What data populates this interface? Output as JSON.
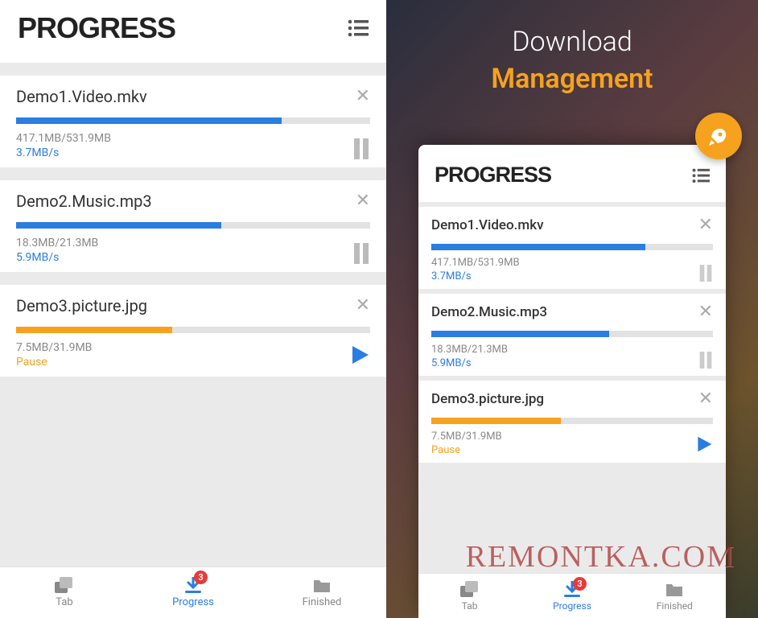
{
  "left": {
    "header_title": "PROGRESS",
    "items": [
      {
        "name": "Demo1.Video.mkv",
        "size": "417.1MB/531.9MB",
        "speed": "3.7MB/s",
        "percent": 75,
        "color": "blue",
        "action": "pause"
      },
      {
        "name": "Demo2.Music.mp3",
        "size": "18.3MB/21.3MB",
        "speed": "5.9MB/s",
        "percent": 58,
        "color": "blue",
        "action": "pause"
      },
      {
        "name": "Demo3.picture.jpg",
        "size": "7.5MB/31.9MB",
        "status": "Pause",
        "percent": 44,
        "color": "orange",
        "action": "play"
      }
    ],
    "nav": {
      "tab_label": "Tab",
      "progress_label": "Progress",
      "finished_label": "Finished",
      "badge": "3"
    }
  },
  "right": {
    "promo_line1": "Download",
    "promo_line2": "Management",
    "header_title": "PROGRESS",
    "items": [
      {
        "name": "Demo1.Video.mkv",
        "size": "417.1MB/531.9MB",
        "speed": "3.7MB/s",
        "percent": 76,
        "color": "blue",
        "action": "pause"
      },
      {
        "name": "Demo2.Music.mp3",
        "size": "18.3MB/21.3MB",
        "speed": "5.9MB/s",
        "percent": 63,
        "color": "blue",
        "action": "pause"
      },
      {
        "name": "Demo3.picture.jpg",
        "size": "7.5MB/31.9MB",
        "status": "Pause",
        "percent": 46,
        "color": "orange",
        "action": "play"
      }
    ],
    "nav": {
      "tab_label": "Tab",
      "progress_label": "Progress",
      "finished_label": "Finished",
      "badge": "3"
    }
  },
  "watermark": "REMONTKA.COM"
}
